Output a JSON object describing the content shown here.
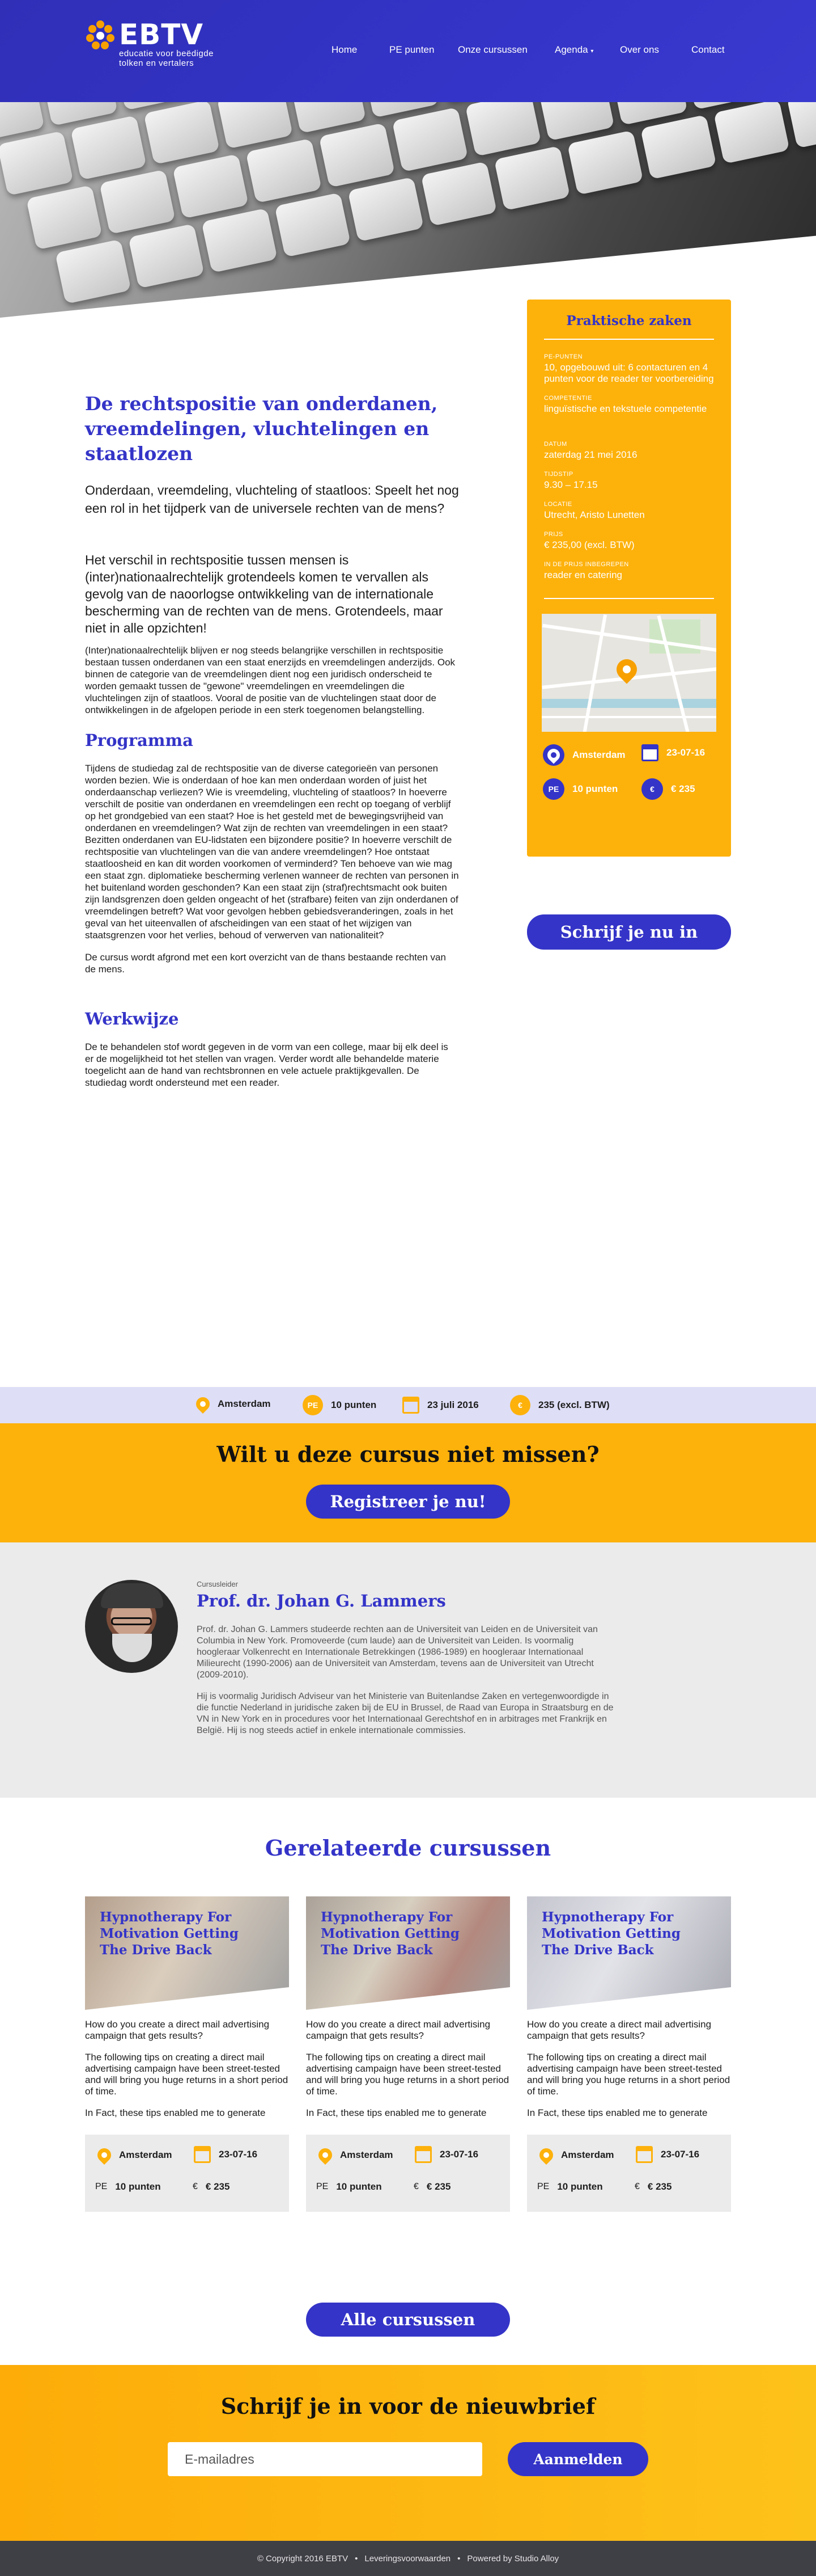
{
  "header": {
    "logo": {
      "word": "EBTV",
      "tagline_1": "educatie voor beëdigde",
      "tagline_2": "tolken en vertalers"
    },
    "nav": [
      {
        "label": "Home"
      },
      {
        "label": "PE punten"
      },
      {
        "label": "Onze cursussen"
      },
      {
        "label": "Agenda"
      },
      {
        "label": "Over ons"
      },
      {
        "label": "Contact"
      }
    ]
  },
  "course": {
    "title": "De rechtspositie van onderdanen, vreemdelingen, vluchtelingen en staatlozen",
    "subtitle": "Onderdaan, vreemdeling, vluchteling of staatloos: Speelt het nog een rol in het tijdperk van de universele rechten van de mens?",
    "lead": "Het verschil in rechtspositie tussen mensen is (inter)nationaalrechtelijk grotendeels komen te vervallen als gevolg van de naoorlogse ontwikkeling van de internationale bescherming van de rechten van de mens. Grotendeels, maar niet in alle opzichten!",
    "intro": "(Inter)nationaalrechtelijk blijven er nog steeds belangrijke verschillen in rechtspositie bestaan tussen onderdanen van een staat enerzijds en vreemdelingen anderzijds. Ook binnen de categorie van de vreemdelingen dient nog een juridisch onderscheid te worden gemaakt tussen de \"gewone\" vreemdelingen en vreemdelingen die vluchtelingen zijn of staatloos. Vooral de positie van de vluchtelingen staat door de ontwikkelingen in de afgelopen periode in een sterk toegenomen belangstelling.",
    "programma_heading": "Programma",
    "programma_1": "Tijdens de studiedag zal de rechtspositie van de diverse categorieën van personen worden bezien. Wie is onderdaan of hoe kan men onderdaan worden of juist het onderdaanschap verliezen? Wie is vreemdeling, vluchteling of staatloos? In hoeverre verschilt de positie van onderdanen en vreemdelingen een recht op toegang of verblijf op het grondgebied van een staat? Hoe is het gesteld met de bewegingsvrijheid van onderdanen en vreemdelingen? Wat zijn de rechten van vreemdelingen in een staat? Bezitten onderdanen van EU-lidstaten een bijzondere positie? In hoeverre verschilt de rechtspositie van vluchtelingen van die van andere vreemdelingen? Hoe ontstaat staatloosheid en kan dit worden voorkomen of verminderd? Ten behoeve van wie mag een staat zgn. diplomatieke bescherming verlenen wanneer de rechten van personen in het buitenland worden geschonden? Kan een staat zijn (straf)rechtsmacht ook buiten zijn landsgrenzen doen gelden ongeacht of het (strafbare) feiten van zijn onderdanen of vreemdelingen betreft? Wat voor gevolgen hebben gebiedsveranderingen, zoals in het geval van het uiteenvallen of afscheidingen van een staat of het wijzigen van staatsgrenzen voor het verlies, behoud of verwerven van nationaliteit?",
    "programma_2": "De cursus wordt afgrond met een kort overzicht van de thans bestaande rechten van de mens.",
    "werkwijze_heading": "Werkwijze",
    "werkwijze": "De te behandelen stof wordt gegeven in de vorm van een college, maar bij elk deel is er de mogelijkheid tot het stellen van vragen. Verder wordt alle behandelde materie toegelicht aan de hand van rechtsbronnen en vele actuele praktijkgevallen. De studiedag wordt ondersteund met een reader."
  },
  "sidebar": {
    "title": "Praktische zaken",
    "items": [
      {
        "label": "PE-PUNTEN",
        "value": "10, opgebouwd uit: 6 contacturen en 4 punten voor de reader ter voorbereiding"
      },
      {
        "label": "COMPETENTIE",
        "value": "linguïstische en tekstuele competentie"
      },
      {
        "label": "DATUM",
        "value": "zaterdag 21 mei 2016"
      },
      {
        "label": "TIJDSTIP",
        "value": "9.30 – 17.15"
      },
      {
        "label": "LOCATIE",
        "value": "Utrecht, Aristo Lunetten"
      },
      {
        "label": "PRIJS",
        "value": "€ 235,00 (excl. BTW)"
      },
      {
        "label": "IN DE PRIJS INBEGREPEN",
        "value": "reader en catering"
      }
    ],
    "facts": {
      "location": "Amsterdam",
      "date": "23-07-16",
      "points": "10 punten",
      "price": "€ 235",
      "pe_badge": "PE",
      "euro_badge": "€"
    },
    "cta": "Schrijf je nu in"
  },
  "strip": {
    "location": "Amsterdam",
    "pe_badge": "PE",
    "points": "10 punten",
    "date": "23 juli 2016",
    "euro_badge": "€",
    "price": "235 (excl. BTW)"
  },
  "cta_block": {
    "heading": "Wilt u deze cursus niet missen?",
    "button": "Registreer je nu!"
  },
  "lecturer": {
    "role": "Cursusleider",
    "name": "Prof. dr. Johan G. Lammers",
    "bio_1": "Prof. dr. Johan G. Lammers studeerde rechten aan de Universiteit van Leiden en de Universiteit van Columbia in New York. Promoveerde (cum laude) aan de Universiteit van Leiden. Is voormalig hoogleraar Volkenrecht en Internationale Betrekkingen (1986-1989) en hoogleraar Internationaal Milieurecht (1990-2006) aan de Universiteit van Amsterdam, tevens aan de Universiteit van Utrecht (2009-2010).",
    "bio_2": "Hij is voormalig Juridisch Adviseur van het Ministerie van Buitenlandse Zaken en vertegenwoordigde in die functie Nederland in juridische zaken bij de EU in Brussel, de Raad van Europa in Straatsburg en de VN in New York en in procedures voor het Internationaal Gerechtshof en in arbitrages met Frankrijk en België. Hij is nog steeds actief in enkele internationale commissies."
  },
  "related": {
    "heading": "Gerelateerde cursussen",
    "cards": [
      {
        "title": "Hypnotherapy For Motivation Getting The Drive Back",
        "question": "How do you create a direct mail advertising campaign that gets results?",
        "paragraph": "The following tips on creating a direct mail advertising campaign have been street-tested and will bring you huge returns in a short period of time.",
        "more": "In Fact, these tips enabled me to generate",
        "location": "Amsterdam",
        "date": "23-07-16",
        "points": "10 punten",
        "price": "€ 235",
        "pe_badge": "PE",
        "euro_badge": "€"
      },
      {
        "title": "Hypnotherapy For Motivation Getting The Drive Back",
        "question": "How do you create a direct mail advertising campaign that gets results?",
        "paragraph": "The following tips on creating a direct mail advertising campaign have been street-tested and will bring you huge returns in a short period of time.",
        "more": "In Fact, these tips enabled me to generate",
        "location": "Amsterdam",
        "date": "23-07-16",
        "points": "10 punten",
        "price": "€ 235",
        "pe_badge": "PE",
        "euro_badge": "€"
      },
      {
        "title": "Hypnotherapy For Motivation Getting The Drive Back",
        "question": "How do you create a direct mail advertising campaign that gets results?",
        "paragraph": "The following tips on creating a direct mail advertising campaign have been street-tested and will bring you huge returns in a short period of time.",
        "more": "In Fact, these tips enabled me to generate",
        "location": "Amsterdam",
        "date": "23-07-16",
        "points": "10 punten",
        "price": "€ 235",
        "pe_badge": "PE",
        "euro_badge": "€"
      }
    ],
    "all_button": "Alle cursussen"
  },
  "newsletter": {
    "heading": "Schrijf je in voor de nieuwbrief",
    "email_placeholder": "E-mailadres",
    "button": "Aanmelden"
  },
  "footer": {
    "copyright": "© Copyright  2016  EBTV",
    "sep": "•",
    "terms": "Leveringsvoorwaarden",
    "powered": "Powered by Studio Alloy"
  },
  "colors": {
    "brand_blue": "#3434c8",
    "accent_yellow": "#fdb10b",
    "strip_bg": "#dedef7",
    "lecturer_bg": "#ebebeb",
    "footer_bg": "#3f3f46"
  },
  "icons": [
    "location-pin-icon",
    "calendar-icon",
    "pe-badge-icon",
    "euro-badge-icon",
    "dropdown-caret-icon",
    "map-marker-icon"
  ]
}
